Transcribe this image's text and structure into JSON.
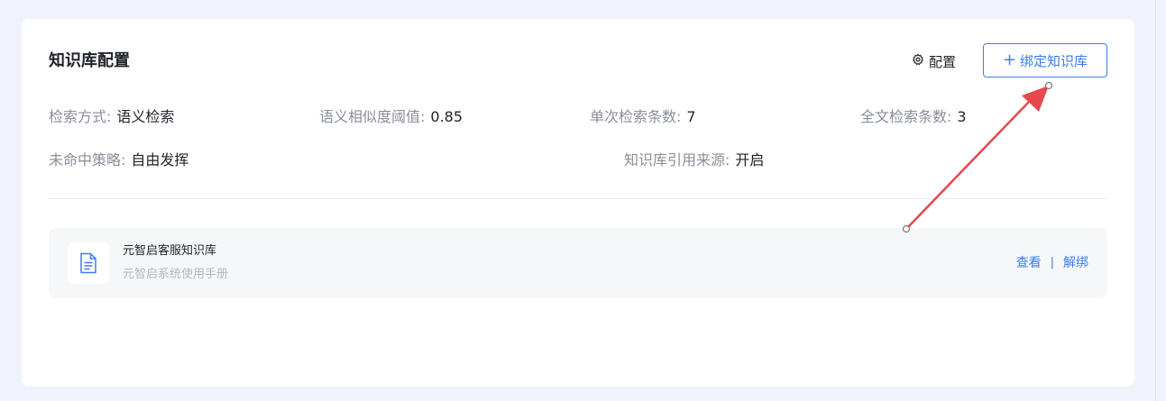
{
  "section": {
    "title": "知识库配置",
    "config_label": "配置",
    "bind_label": "绑定知识库"
  },
  "settings": {
    "retrieval_mode": {
      "label": "检索方式:",
      "value": "语义检索"
    },
    "similarity_threshold": {
      "label": "语义相似度阈值:",
      "value": "0.85"
    },
    "single_retrieval_count": {
      "label": "单次检索条数:",
      "value": "7"
    },
    "fulltext_retrieval_count": {
      "label": "全文检索条数:",
      "value": "3"
    },
    "miss_strategy": {
      "label": "未命中策略:",
      "value": "自由发挥"
    },
    "citation_source": {
      "label": "知识库引用来源:",
      "value": "开启"
    }
  },
  "knowledge_bases": [
    {
      "name": "元智启客服知识库",
      "description": "元智启系统使用手册",
      "view_label": "查看",
      "separator": "|",
      "unbind_label": "解绑"
    }
  ],
  "colors": {
    "accent": "#3a7ef0",
    "annotation_arrow": "#e5484d"
  }
}
